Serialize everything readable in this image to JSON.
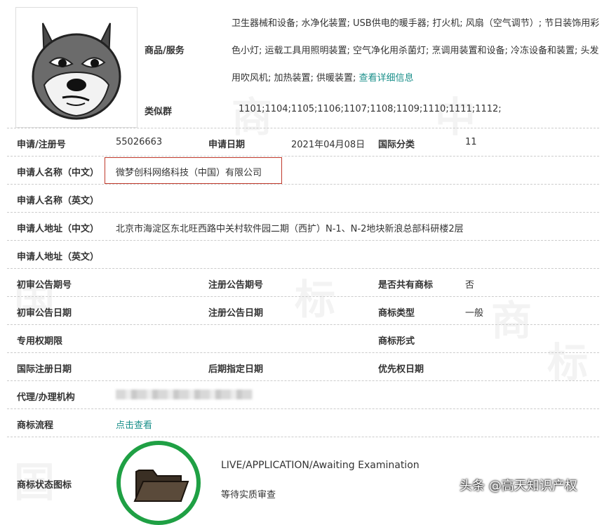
{
  "goods_label": "商品/服务",
  "goods_text": "卫生器械和设备; 水净化装置; USB供电的暖手器; 打火机; 风扇（空气调节）; 节日装饰用彩色小灯; 运载工具用照明装置; 空气净化用杀菌灯; 烹调用装置和设备; 冷冻设备和装置; 头发用吹风机; 加热装置; 供暖装置;",
  "goods_link": "查看详细信息",
  "similar_label": "类似群",
  "similar_value": "1101;1104;1105;1106;1107;1108;1109;1110;1111;1112;",
  "reg_no_label": "申请/注册号",
  "reg_no": "55026663",
  "apply_date_label": "申请日期",
  "apply_date": "2021年04月08日",
  "intl_class_label": "国际分类",
  "intl_class": "11",
  "applicant_cn_label": "申请人名称（中文）",
  "applicant_cn": "微梦创科网络科技（中国）有限公司",
  "applicant_en_label": "申请人名称（英文）",
  "address_cn_label": "申请人地址（中文）",
  "address_cn": "北京市海淀区东北旺西路中关村软件园二期（西扩）N-1、N-2地块新浪总部科研楼2层",
  "address_en_label": "申请人地址（英文）",
  "prelim_no_label": "初审公告期号",
  "reg_pub_no_label": "注册公告期号",
  "shared_label": "是否共有商标",
  "shared_value": "否",
  "prelim_date_label": "初审公告日期",
  "reg_pub_date_label": "注册公告日期",
  "tm_type_label": "商标类型",
  "tm_type_value": "一般",
  "exclusive_label": "专用权期限",
  "tm_form_label": "商标形式",
  "intl_reg_label": "国际注册日期",
  "later_date_label": "后期指定日期",
  "priority_label": "优先权日期",
  "agent_label": "代理/办理机构",
  "flow_label": "商标流程",
  "flow_link": "点击查看",
  "status_icon_label": "商标状态图标",
  "status_en": "LIVE/APPLICATION/Awaiting Examination",
  "status_cn": "等待实质审查",
  "footer_watermark": "头条 @高天知识产权",
  "watermark_chars": [
    "中",
    "国",
    "商",
    "标"
  ],
  "colors": {
    "link": "#1a8f8a",
    "status_ring": "#1fa044",
    "highlight_box": "#c0392b"
  }
}
